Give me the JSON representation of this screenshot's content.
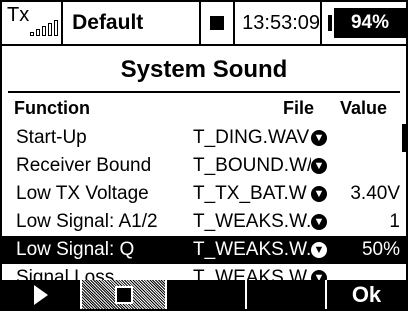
{
  "status_bar": {
    "tx_label": "Tx",
    "model_name": "Default",
    "time": "13:53:09",
    "battery": "94%"
  },
  "title": "System Sound",
  "columns": {
    "function": "Function",
    "file": "File",
    "value": "Value"
  },
  "rows": [
    {
      "function": "Start-Up",
      "file": "T_DING.WAV",
      "value": ""
    },
    {
      "function": "Receiver Bound",
      "file": "T_BOUND.W/",
      "value": ""
    },
    {
      "function": "Low TX Voltage",
      "file": "T_TX_BAT.W",
      "value": "3.40V"
    },
    {
      "function": "Low Signal: A1/2",
      "file": "T_WEAKS.W.",
      "value": "1"
    },
    {
      "function": "Low Signal: Q",
      "file": "T_WEAKS.W.",
      "value": "50%",
      "selected": true
    },
    {
      "function": "Signal Loss",
      "file": "T_WEAKS.W",
      "value": ""
    }
  ],
  "bottom_bar": {
    "ok_label": "Ok"
  },
  "icons": {
    "play": "play-icon",
    "stop": "stop-icon",
    "download": "download-arrow-icon"
  }
}
